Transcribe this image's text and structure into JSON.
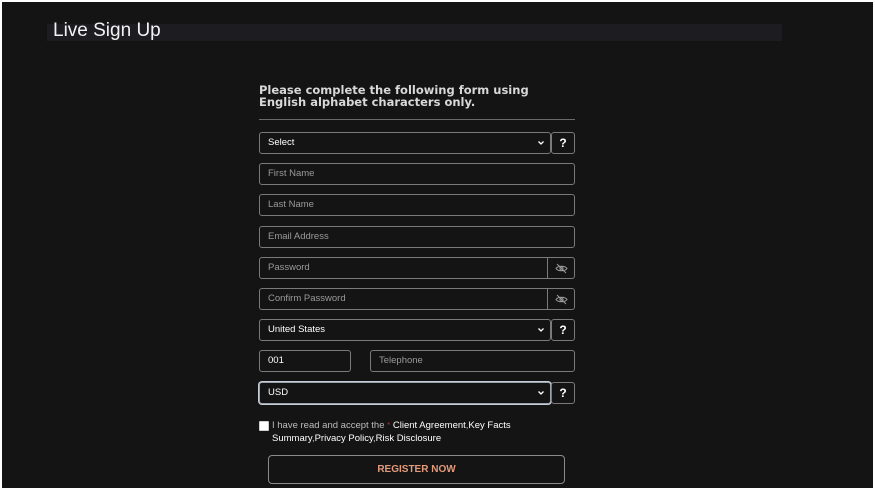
{
  "page": {
    "title": "Live Sign Up",
    "instructions": "Please complete the following form using English alphabet characters only."
  },
  "form": {
    "title_select": {
      "value": "Select",
      "help_label": "?"
    },
    "first_name": {
      "placeholder": "First Name"
    },
    "last_name": {
      "placeholder": "Last Name"
    },
    "email": {
      "placeholder": "Email Address"
    },
    "password": {
      "placeholder": "Password",
      "toggle_icon": "eye-slash-icon"
    },
    "confirm_password": {
      "placeholder": "Confirm Password",
      "toggle_icon": "eye-slash-icon"
    },
    "country": {
      "value": "United States",
      "help_label": "?"
    },
    "phone_code": {
      "value": "001"
    },
    "telephone": {
      "placeholder": "Telephone"
    },
    "currency": {
      "value": "USD",
      "help_label": "?"
    },
    "agreement": {
      "checked": false,
      "prefix": "I have read and accept the ",
      "required_mark": "*",
      "client_agreement": "Client Agreement",
      "sep1": ",",
      "key_facts": "Key Facts Summary",
      "sep2": ",",
      "privacy_policy": "Privacy Policy",
      "sep3": ",",
      "risk_disclosure": "Risk Disclosure"
    },
    "register_label": "REGISTER NOW"
  },
  "colors": {
    "background": "#151414",
    "field_border": "#7a7a7a",
    "register_text": "#e29b7a",
    "text": "#ffffff"
  }
}
